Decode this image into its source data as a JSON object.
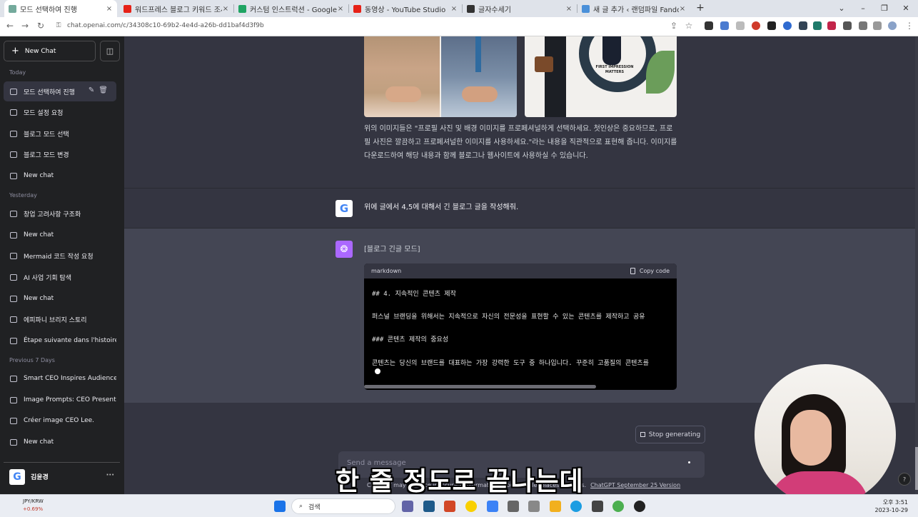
{
  "browser": {
    "tabs": [
      {
        "title": "모드 선택하여 진행",
        "color": "#74aa9c",
        "active": true
      },
      {
        "title": "워드프레스 블로그 키워드 조사",
        "color": "#e62117"
      },
      {
        "title": "커스텀 인스트럭션 - Google Sh",
        "color": "#1fa463"
      },
      {
        "title": "동영상 - YouTube Studio",
        "color": "#e62117"
      },
      {
        "title": "글자수세기",
        "color": "#333333"
      },
      {
        "title": "새 글 추가 ‹ 랜덤파일 Fandom",
        "color": "#4a90d9"
      }
    ],
    "new_tab": "+",
    "close": "×",
    "url": "chat.openai.com/c/34308c10-69b2-4e4d-a26b-dd1baf4d3f9b"
  },
  "sidebar": {
    "new_chat": "New Chat",
    "today_label": "Today",
    "today": [
      "모드 선택하여 진행",
      "모드 설정 요청",
      "블로그 모드 선택",
      "블로그 모드 변경",
      "New chat"
    ],
    "yesterday_label": "Yesterday",
    "yesterday": [
      "창업 고려사항 구조화",
      "New chat",
      "Mermaid 코드 작성 요청",
      "AI 사업 기회 탐색",
      "New chat",
      "에피파니 브리지 스토리",
      "Étape suivante dans l'histoire"
    ],
    "prev7_label": "Previous 7 Days",
    "prev7": [
      "Smart CEO Inspires Audience",
      "Image Prompts: CEO Present",
      "Créer image CEO Lee.",
      "New chat"
    ],
    "user_name": "김윤경",
    "user_initial": "G",
    "more": "···"
  },
  "chat": {
    "image_caption": "FIRST IMPRESSION MATTERS",
    "paragraph": "위의 이미지들은 \"프로필 사진 및 배경 이미지를 프로페셔널하게 선택하세요. 첫인상은 중요하므로, 프로필 사진은 깔끔하고 프로페셔널한 이미지를 사용하세요.\"라는 내용을 직관적으로 표현해 줍니다. 이미지를 다운로드하여 해당 내용과 함께 블로그나 웹사이트에 사용하실 수 있습니다.",
    "user_initial": "G",
    "user_message": "위에 글에서 4,5에 대해서 긴 블로그 글을 작성해줘.",
    "assistant_message": "[블로그 긴글 모드]",
    "code_lang": "markdown",
    "copy_code": "Copy code",
    "code_lines": [
      "## 4. 지속적인 콘텐츠 제작",
      "퍼스널 브랜딩을 위해서는 지속적으로 자신의 전문성을 표현할 수 있는 콘텐츠를 제작하고 공유",
      "### 콘텐츠 제작의 중요성",
      "콘텐츠는 당신의 브랜드를 대표하는 가장 강력한 도구 중 하나입니다. 꾸준히 고품질의 콘텐츠를"
    ],
    "stop_generating": "Stop generating",
    "input_placeholder": "Send a message",
    "footer_text": "ChatGPT may produce inaccurate information about people, places, or facts.",
    "footer_link": "ChatGPT September 25 Version",
    "help": "?"
  },
  "subtitle": "한 줄 정도로 끝나는데",
  "taskbar": {
    "stock_pair": "JPY/KRW",
    "stock_change": "+0.69%",
    "search_placeholder": "검색",
    "time": "오후 3:51",
    "date": "2023-10-29"
  },
  "colors": {
    "sidebar": "#202123",
    "main": "#343541",
    "assistant_row": "#444654",
    "gpt_avatar": "#ab68ff"
  }
}
